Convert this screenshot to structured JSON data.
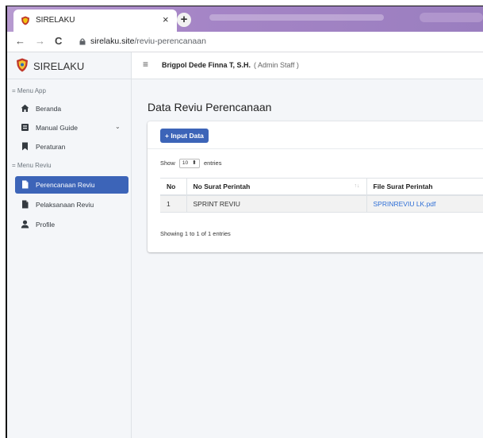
{
  "browser": {
    "tab_title": "SIRELAKU",
    "close_glyph": "×",
    "newtab_glyph": "+",
    "url_host": "sirelaku.site",
    "url_path": "/reviu-perencanaan",
    "back_glyph": "←",
    "forward_glyph": "→",
    "reload_glyph": "C"
  },
  "app": {
    "brand": "SIRELAKU",
    "hamburger": "≡",
    "user_name": "Brigpol Dede Finna T, S.H.",
    "user_role": "( Admin Staff )"
  },
  "sidebar": {
    "header_menu_app": "= Menu App",
    "header_menu_reviu": "= Menu Reviu",
    "items": [
      {
        "label": "Beranda",
        "icon": "home-icon"
      },
      {
        "label": "Manual Guide",
        "icon": "book-icon",
        "chevron": "⌄"
      },
      {
        "label": "Peraturan",
        "icon": "bookmark-icon"
      },
      {
        "label": "Perencanaan Reviu",
        "icon": "file-icon",
        "active": true
      },
      {
        "label": "Pelaksanaan Reviu",
        "icon": "file-icon"
      },
      {
        "label": "Profile",
        "icon": "user-icon"
      }
    ],
    "active_color": "#3c64b8"
  },
  "main": {
    "title": "Data Reviu Perencanaan",
    "input_button": "+ Input Data",
    "show_label": "Show",
    "entries_value": "10",
    "entries_label": "entries",
    "columns": [
      "No",
      "No Surat Perintah",
      "File Surat Perintah"
    ],
    "rows": [
      {
        "no": "1",
        "no_surat": "SPRINT REVIU",
        "file": "SPRINREVIU LK.pdf"
      }
    ],
    "info": "Showing 1 to 1 of 1 entries",
    "sort_glyph": "↑↓"
  }
}
